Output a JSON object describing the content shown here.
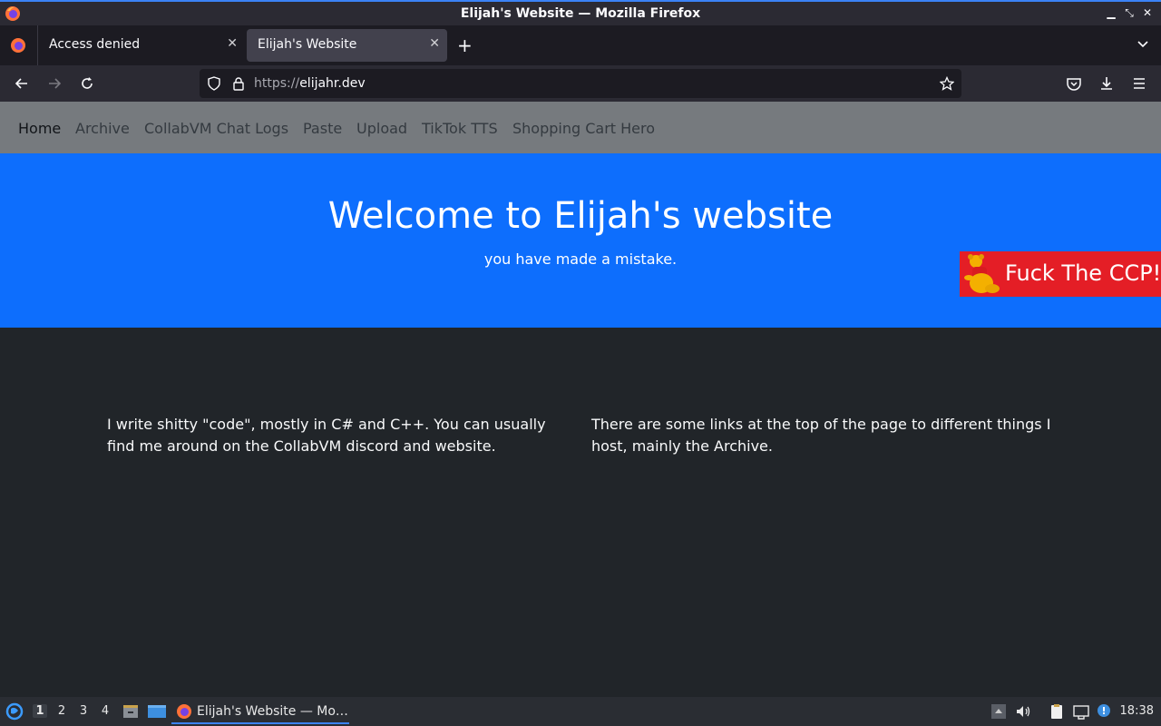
{
  "window": {
    "title": "Elijah's Website — Mozilla Firefox"
  },
  "tabs": [
    {
      "label": "Access denied",
      "active": false
    },
    {
      "label": "Elijah's Website",
      "active": true
    }
  ],
  "urlbar": {
    "scheme": "https://",
    "host": "elijahr.dev"
  },
  "site_nav": {
    "items": [
      "Home",
      "Archive",
      "CollabVM Chat Logs",
      "Paste",
      "Upload",
      "TikTok TTS",
      "Shopping Cart Hero"
    ]
  },
  "hero": {
    "title": "Welcome to Elijah's website",
    "subtitle": "you have made a mistake.",
    "banner_text": "Fuck The CCP!"
  },
  "content": {
    "left": "I write shitty \"code\", mostly in C# and C++. You can usually find me around on the CollabVM discord and website.",
    "right": "There are some links at the top of the page to different things I host, mainly the Archive."
  },
  "taskbar": {
    "workspaces": [
      "1",
      "2",
      "3",
      "4"
    ],
    "task_label": "Elijah's Website — Mo…",
    "clock": "18:38"
  },
  "colors": {
    "hero_bg": "#0d6efd",
    "page_bg": "#212529",
    "nav_bg": "#767a7e",
    "banner_bg": "#e41e26"
  }
}
